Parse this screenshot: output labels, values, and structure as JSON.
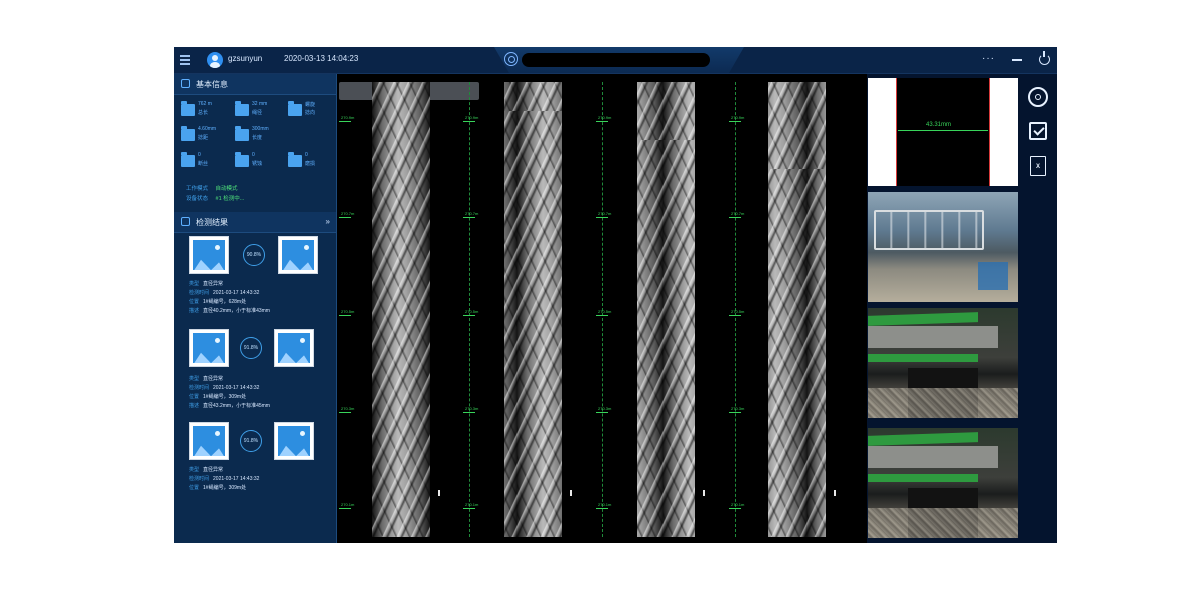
{
  "topbar": {
    "username": "gzsunyun",
    "datetime": "2020-03-13  14:04:23",
    "more_label": "···"
  },
  "basic_info": {
    "title": "基本信息",
    "items": [
      {
        "value": "762 m",
        "label": "总长"
      },
      {
        "value": "32 mm",
        "label": "绳径"
      },
      {
        "value": "螺旋",
        "label": "捻向"
      },
      {
        "value": "4.60mm",
        "label": "捻距"
      },
      {
        "value": "300mm",
        "label": "长度"
      },
      {
        "value": "0",
        "label": "断丝"
      },
      {
        "value": "0",
        "label": "锈蚀"
      },
      {
        "value": "0",
        "label": "磨损"
      },
      {
        "value": "0",
        "label": "其他"
      }
    ],
    "work_mode_label": "工作模式",
    "work_mode_value": "自动模式",
    "device_status_label": "设备状态",
    "device_status_value": "#1 检测中..."
  },
  "results": {
    "title": "检测结果",
    "expand_label": "»",
    "items": [
      {
        "ratio": "90.8%",
        "type_label": "类型",
        "type_value": "直径异常",
        "time_label": "检测时间",
        "time_value": "2021-03-17 14:43:32",
        "pos_label": "位置",
        "pos_value": "1#绳编号，628m处",
        "desc_label": "描述",
        "desc_value": "直径40.2mm，小于标准43mm"
      },
      {
        "ratio": "91.8%",
        "type_label": "类型",
        "type_value": "直径异常",
        "time_label": "检测时间",
        "time_value": "2021-03-17 14:43:32",
        "pos_label": "位置",
        "pos_value": "1#绳编号，309m处",
        "desc_label": "描述",
        "desc_value": "直径43.2mm，小于标准45mm"
      },
      {
        "ratio": "91.8%",
        "type_label": "类型",
        "type_value": "直径异常",
        "time_label": "检测时间",
        "time_value": "2021-03-17 14:43:32",
        "pos_label": "位置",
        "pos_value": "1#绳编号，309m处"
      }
    ]
  },
  "viewer": {
    "scale_labels": [
      "270.9m",
      "270.7m",
      "270.5m",
      "270.3m",
      "270.1m"
    ]
  },
  "measurement": {
    "label": "43.31mm"
  },
  "right_bar": {
    "excel_label": "X"
  },
  "colors": {
    "panel_bg": "#0b2a4e",
    "accent": "#3f9fe8",
    "status_green": "#4fe27a",
    "scale_green": "#38d45a"
  }
}
